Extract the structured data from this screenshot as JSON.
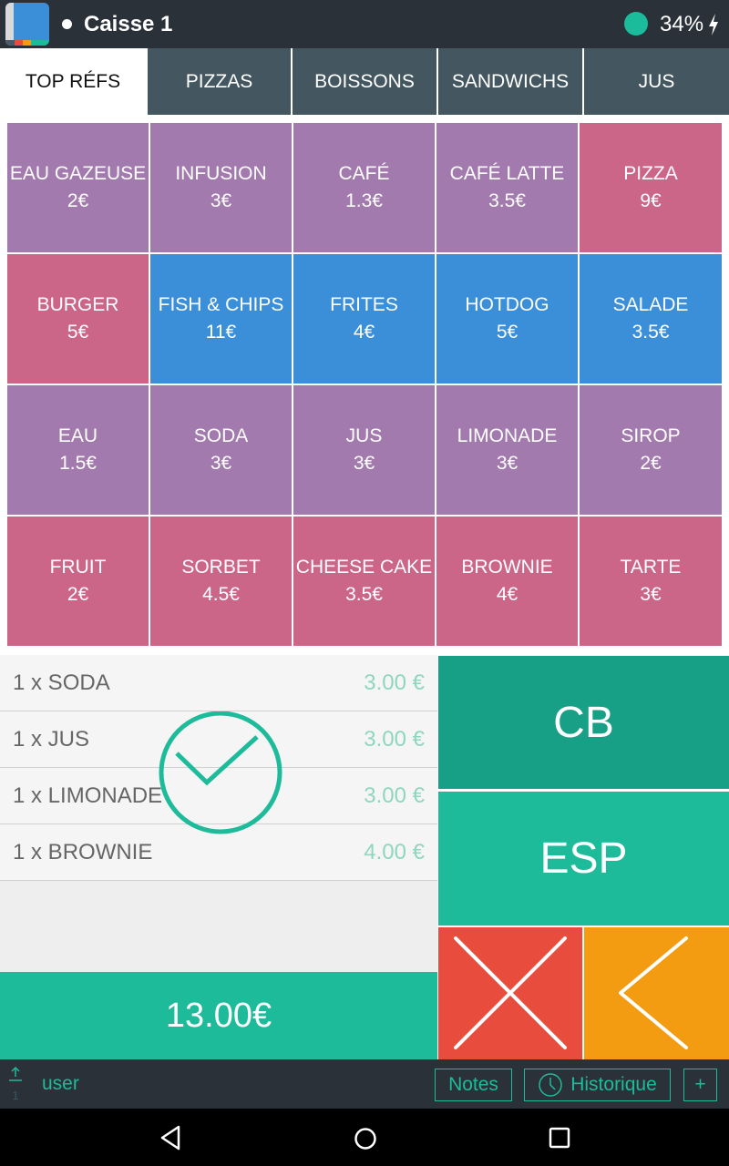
{
  "status_bar": {
    "title": "Caisse 1",
    "battery": "34%",
    "app_icon": "cash-register-app-icon",
    "connection_icon": "online-status-dot"
  },
  "tabs": [
    {
      "label": "TOP RÉFS",
      "active": true
    },
    {
      "label": "PIZZAS",
      "active": false
    },
    {
      "label": "BOISSONS",
      "active": false
    },
    {
      "label": "SANDWICHS",
      "active": false
    },
    {
      "label": "JUS",
      "active": false
    }
  ],
  "colors": {
    "purple": "#a27aae",
    "pink": "#cc6688",
    "blue": "#3a8fd8",
    "teal": "#1dbb9a",
    "teal_dark": "#17a085",
    "red": "#e74c3c",
    "orange": "#f39c12",
    "dark": "#2a3138",
    "tab_bg": "#445760"
  },
  "products": [
    {
      "name": "EAU GAZEUSE",
      "price": "2€",
      "color": "#a27aae"
    },
    {
      "name": "INFUSION",
      "price": "3€",
      "color": "#a27aae"
    },
    {
      "name": "CAFÉ",
      "price": "1.3€",
      "color": "#a27aae"
    },
    {
      "name": "CAFÉ LATTE",
      "price": "3.5€",
      "color": "#a27aae"
    },
    {
      "name": "PIZZA",
      "price": "9€",
      "color": "#cc6688"
    },
    {
      "name": "BURGER",
      "price": "5€",
      "color": "#cc6688"
    },
    {
      "name": "FISH & CHIPS",
      "price": "11€",
      "color": "#3a8fd8"
    },
    {
      "name": "FRITES",
      "price": "4€",
      "color": "#3a8fd8"
    },
    {
      "name": "HOTDOG",
      "price": "5€",
      "color": "#3a8fd8"
    },
    {
      "name": "SALADE",
      "price": "3.5€",
      "color": "#3a8fd8"
    },
    {
      "name": "EAU",
      "price": "1.5€",
      "color": "#a27aae"
    },
    {
      "name": "SODA",
      "price": "3€",
      "color": "#a27aae"
    },
    {
      "name": "JUS",
      "price": "3€",
      "color": "#a27aae"
    },
    {
      "name": "LIMONADE",
      "price": "3€",
      "color": "#a27aae"
    },
    {
      "name": "SIROP",
      "price": "2€",
      "color": "#a27aae"
    },
    {
      "name": "FRUIT",
      "price": "2€",
      "color": "#cc6688"
    },
    {
      "name": "SORBET",
      "price": "4.5€",
      "color": "#cc6688"
    },
    {
      "name": "CHEESE CAKE",
      "price": "3.5€",
      "color": "#cc6688"
    },
    {
      "name": "BROWNIE",
      "price": "4€",
      "color": "#cc6688"
    },
    {
      "name": "TARTE",
      "price": "3€",
      "color": "#cc6688"
    }
  ],
  "order": {
    "lines": [
      {
        "label": "1 x SODA",
        "amount": "3.00 €"
      },
      {
        "label": "1 x JUS",
        "amount": "3.00 €"
      },
      {
        "label": "1 x LIMONADE",
        "amount": "3.00 €"
      },
      {
        "label": "1 x BROWNIE",
        "amount": "4.00 €"
      }
    ],
    "total": "13.00€",
    "confirmation_icon": "check-circle-icon"
  },
  "payment": {
    "card_label": "CB",
    "cash_label": "ESP",
    "cancel_icon": "close-icon",
    "back_icon": "chevron-left-icon"
  },
  "toolbar": {
    "sync_count": "1",
    "user": "user",
    "notes_label": "Notes",
    "history_label": "Historique",
    "add_label": "+"
  },
  "nav": {
    "back": "back-icon",
    "home": "home-icon",
    "recents": "recents-icon"
  }
}
